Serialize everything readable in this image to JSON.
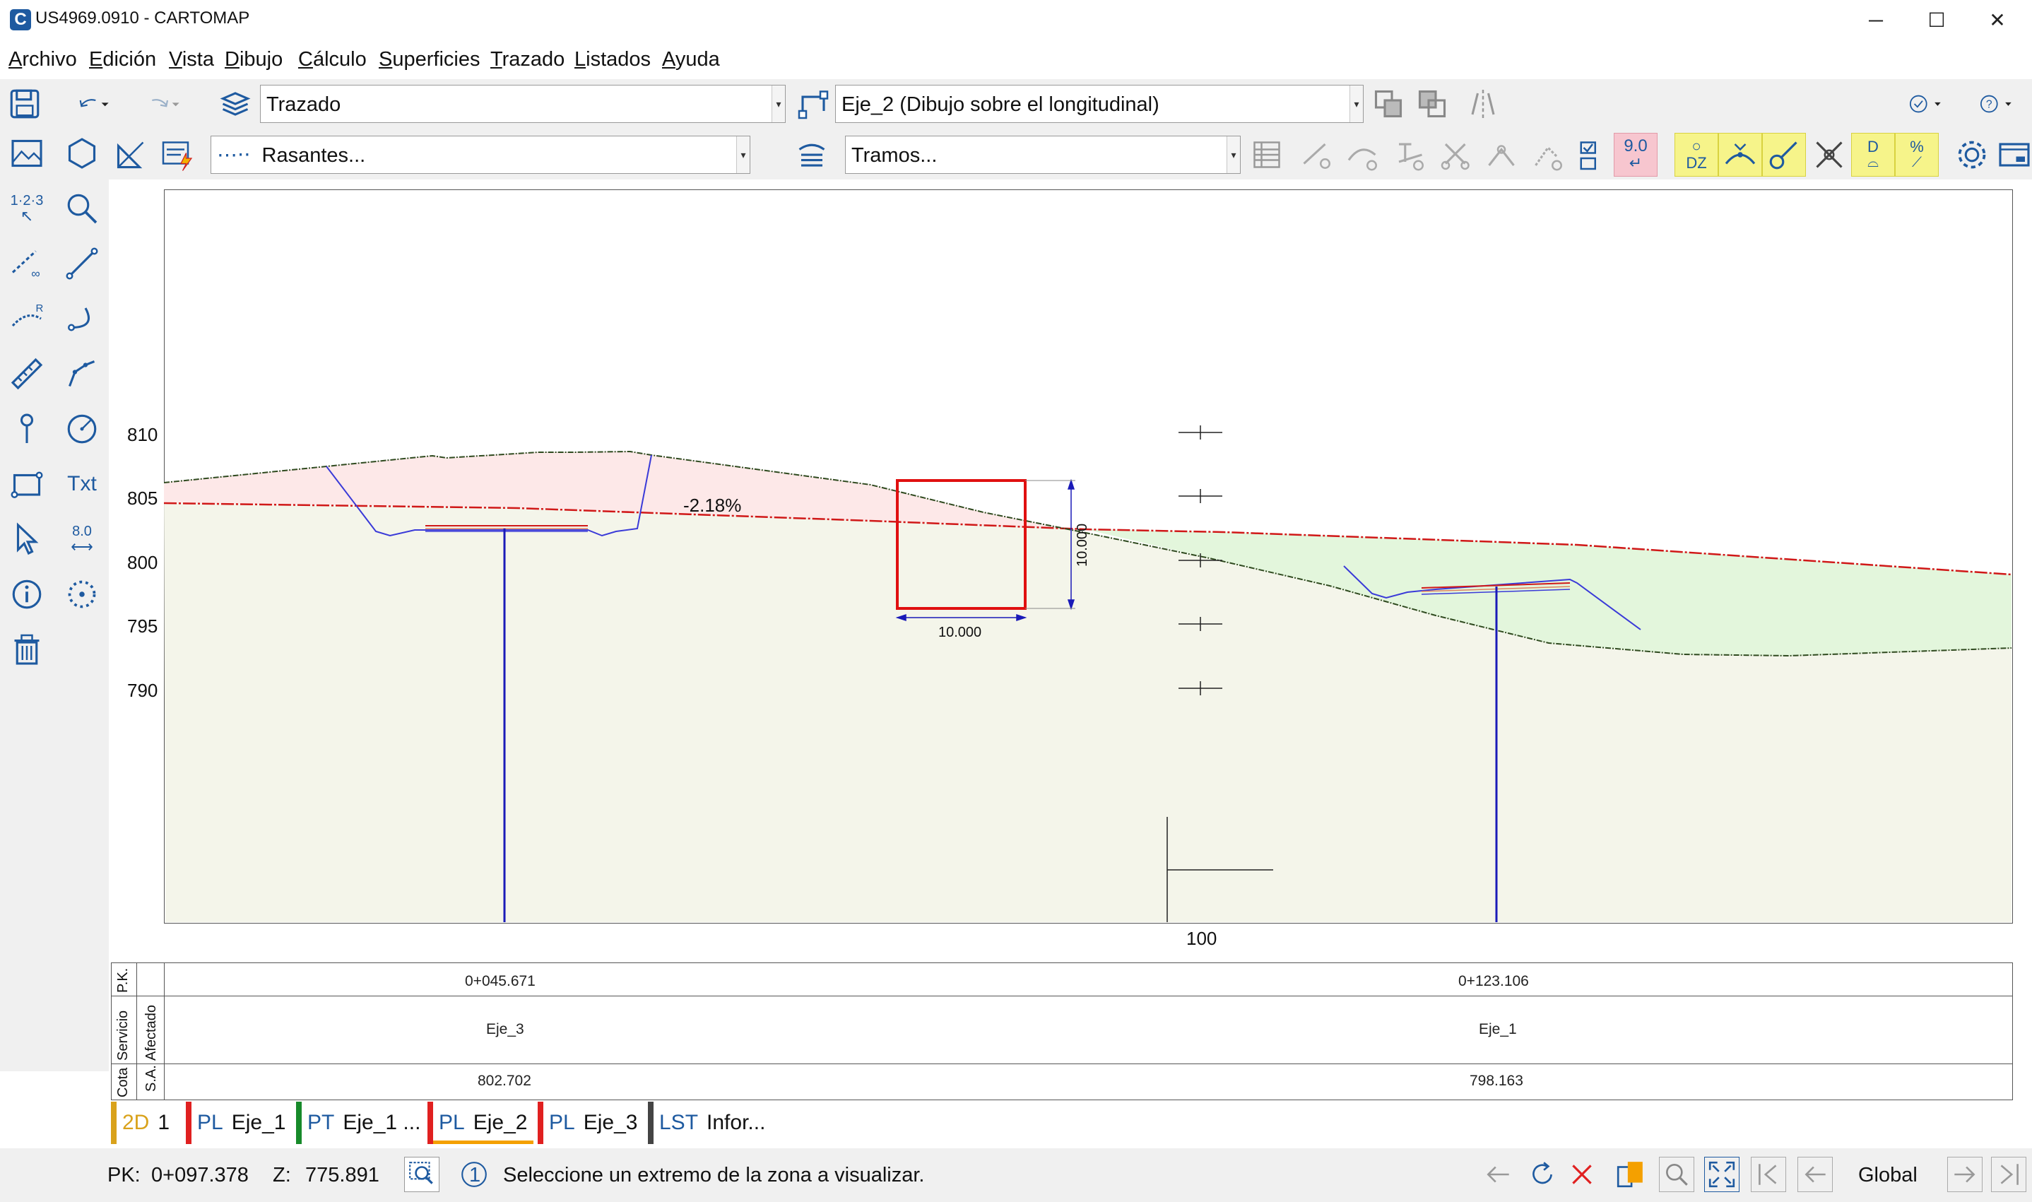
{
  "window": {
    "title": "US4969.0910 - CARTOMAP",
    "minimize": "─",
    "maximize": "☐",
    "close": "✕"
  },
  "menu": [
    "Archivo",
    "Edición",
    "Vista",
    "Dibujo",
    "Cálculo",
    "Superficies",
    "Trazado",
    "Listados",
    "Ayuda"
  ],
  "toolbar": {
    "layer_combo": "Trazado",
    "axis_combo": "Eje_2 (Dibujo sobre el longitudinal)",
    "rasantes_combo": "Rasantes...",
    "tramos_combo": "Tramos...",
    "value_button": "9.0",
    "dz_button": "DZ",
    "d_button": "D",
    "percent_button": "%"
  },
  "left_tools": {
    "numbering": "1·2·3",
    "text": "Txt",
    "measure": "8.0"
  },
  "drawing": {
    "y_axis_labels": [
      "810",
      "805",
      "800",
      "795",
      "790"
    ],
    "x_axis_label": "100",
    "slope_label": "-2.18%",
    "box_width_label": "10.000",
    "box_height_label": "10.000"
  },
  "guitar": {
    "row_labels": {
      "pk": "P.K.",
      "servicio": "Servicio",
      "afectado": "Afectado",
      "cota": "Cota",
      "sa": "S.A."
    },
    "columns": [
      {
        "pk": "0+045.671",
        "afectado": "Eje_3",
        "cota": "802.702"
      },
      {
        "pk": "0+123.106",
        "afectado": "Eje_1",
        "cota": "798.163"
      }
    ]
  },
  "tabs": [
    {
      "code": "2D",
      "name": "1",
      "color": "#d9a21b"
    },
    {
      "code": "PL",
      "name": "Eje_1",
      "color": "#e02020"
    },
    {
      "code": "PT",
      "name": "Eje_1 ...",
      "color": "#178a2a"
    },
    {
      "code": "PL",
      "name": "Eje_2",
      "color": "#e02020"
    },
    {
      "code": "PL",
      "name": "Eje_3",
      "color": "#e02020"
    },
    {
      "code": "LST",
      "name": "Infor...",
      "color": "#444444"
    }
  ],
  "status": {
    "pk_label": "PK:",
    "pk_value": "0+097.378",
    "z_label": "Z:",
    "z_value": "775.891",
    "step": "1",
    "message": "Seleccione un extremo de la zona a visualizar.",
    "mode": "Global"
  },
  "colors": {
    "accent": "#1e5aa0",
    "fill_cut": "#fde8e8",
    "fill_fill": "#e3f6dc",
    "ground_fill": "#f4f5ea",
    "rasante": "#d01818",
    "terrain": "#2f4a1f",
    "pipe": "#1a1ab8",
    "selection_box": "#e01010"
  }
}
